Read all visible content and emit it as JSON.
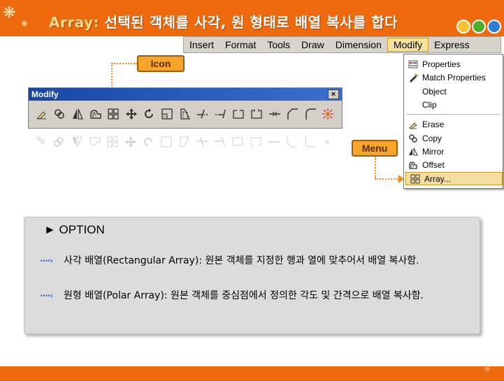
{
  "banner": {
    "title_lead": "Array:",
    "title_rest": " 선택된 객체를 사각, 원 형태로 배열 복사를 합다"
  },
  "menubar": {
    "items": [
      "Insert",
      "Format",
      "Tools",
      "Draw",
      "Dimension",
      "Modify",
      "Express"
    ],
    "active": "Modify"
  },
  "dropdown": {
    "items": [
      {
        "label": "Properties",
        "icon": "properties-icon"
      },
      {
        "label": "Match Properties",
        "icon": "match-properties-icon"
      },
      {
        "label": "Object",
        "icon": ""
      },
      {
        "label": "Clip",
        "icon": ""
      },
      {
        "label": "Erase",
        "icon": "erase-icon"
      },
      {
        "label": "Copy",
        "icon": "copy-icon"
      },
      {
        "label": "Mirror",
        "icon": "mirror-icon"
      },
      {
        "label": "Offset",
        "icon": "offset-icon"
      },
      {
        "label": "Array...",
        "icon": "array-icon"
      }
    ],
    "selected": "Array..."
  },
  "callouts": {
    "icon_label": "Icon",
    "menu_label": "Menu"
  },
  "toolbar": {
    "title": "Modify",
    "close": "×",
    "icons": [
      "erase-icon",
      "copy-icon",
      "mirror-icon",
      "offset-icon",
      "array-icon",
      "move-icon",
      "rotate-icon",
      "scale-icon",
      "stretch-icon",
      "trim-icon",
      "extend-icon",
      "break-at-point-icon",
      "break-icon",
      "join-icon",
      "chamfer-icon",
      "fillet-icon",
      "explode-icon"
    ]
  },
  "panel": {
    "title": "► OPTION",
    "bullets": [
      {
        "marker": "····›",
        "text": "사각 배열(Rectangular Array): 원본 객체를 지정한 행과 열에 맞추어서 배열 복사함."
      },
      {
        "marker": "····›",
        "text": "원형 배열(Polar Array): 원본 객체를 중심점에서 정의한 각도 및 간격으로 배열 복사함."
      }
    ]
  },
  "colors": {
    "brand_orange": "#ee6a0c",
    "callout_fill": "#f7a52a",
    "menu_highlight": "#f5e39c",
    "toolbar_title": "#1747a6"
  }
}
